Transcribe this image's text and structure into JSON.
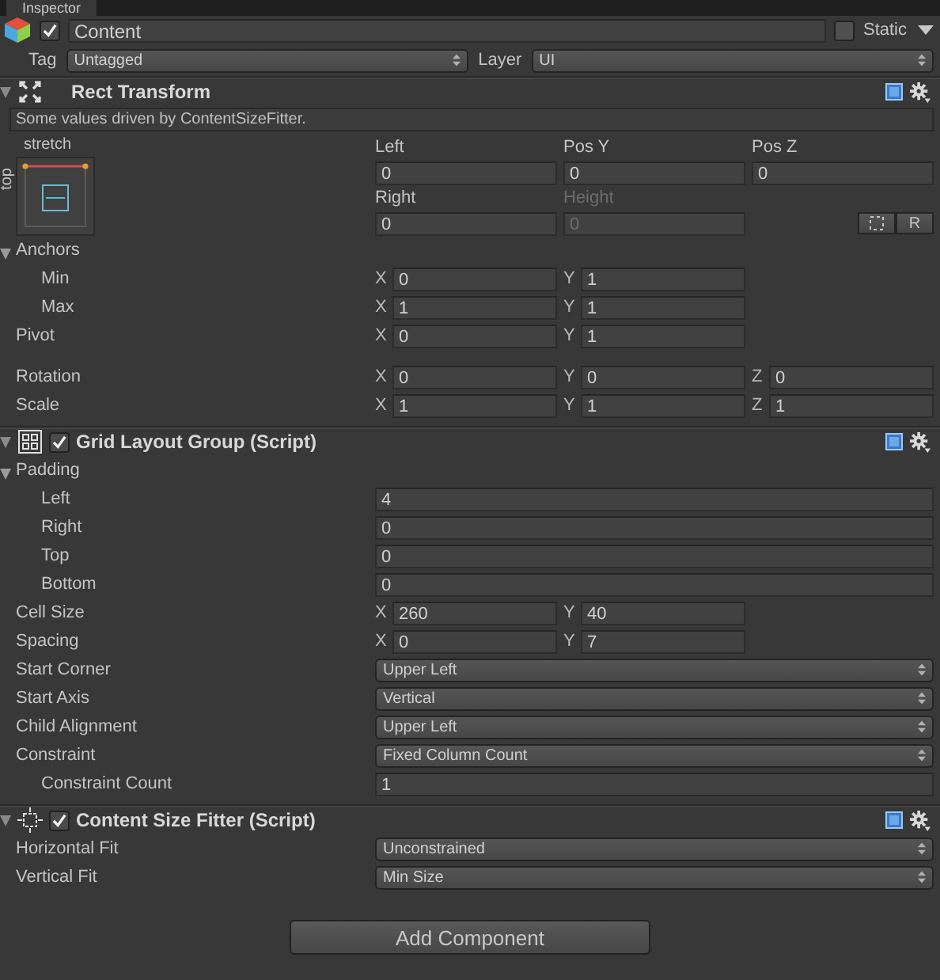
{
  "tab": {
    "title": "Inspector"
  },
  "object": {
    "active": true,
    "name": "Content",
    "static": false,
    "static_label": "Static",
    "tag_label": "Tag",
    "tag": "Untagged",
    "layer_label": "Layer",
    "layer": "UI"
  },
  "components": [
    {
      "kind": "rect_transform",
      "title": "Rect Transform",
      "expanded": true,
      "note": "Some values driven by ContentSizeFitter.",
      "preset_top": "stretch",
      "preset_side": "top",
      "top_fields": [
        {
          "label": "Left",
          "value": "0",
          "disabled": false
        },
        {
          "label": "Pos Y",
          "value": "0",
          "disabled": false
        },
        {
          "label": "Pos Z",
          "value": "0",
          "disabled": false
        },
        {
          "label": "Right",
          "value": "0",
          "disabled": false
        },
        {
          "label": "Height",
          "value": "0",
          "disabled": true
        }
      ],
      "raw_button": "R",
      "rows": [
        {
          "kind": "group",
          "label": "Anchors",
          "expanded": true,
          "children": [
            {
              "kind": "vector",
              "label": "Min",
              "fields": [
                {
                  "axis": "X",
                  "value": "0"
                },
                {
                  "axis": "Y",
                  "value": "1"
                }
              ]
            },
            {
              "kind": "vector",
              "label": "Max",
              "fields": [
                {
                  "axis": "X",
                  "value": "1"
                },
                {
                  "axis": "Y",
                  "value": "1"
                }
              ]
            }
          ]
        },
        {
          "kind": "vector",
          "label": "Pivot",
          "fields": [
            {
              "axis": "X",
              "value": "0"
            },
            {
              "axis": "Y",
              "value": "1"
            }
          ]
        },
        {
          "kind": "vector",
          "label": "Rotation",
          "gap_before": true,
          "fields": [
            {
              "axis": "X",
              "value": "0"
            },
            {
              "axis": "Y",
              "value": "0"
            },
            {
              "axis": "Z",
              "value": "0"
            }
          ]
        },
        {
          "kind": "vector",
          "label": "Scale",
          "fields": [
            {
              "axis": "X",
              "value": "1"
            },
            {
              "axis": "Y",
              "value": "1"
            },
            {
              "axis": "Z",
              "value": "1"
            }
          ]
        }
      ]
    },
    {
      "kind": "grid_layout",
      "title": "Grid Layout Group (Script)",
      "enabled": true,
      "expanded": true,
      "rows": [
        {
          "kind": "group",
          "label": "Padding",
          "expanded": true,
          "children": [
            {
              "kind": "number",
              "label": "Left",
              "value": "4"
            },
            {
              "kind": "number",
              "label": "Right",
              "value": "0"
            },
            {
              "kind": "number",
              "label": "Top",
              "value": "0"
            },
            {
              "kind": "number",
              "label": "Bottom",
              "value": "0"
            }
          ]
        },
        {
          "kind": "vector",
          "label": "Cell Size",
          "fields": [
            {
              "axis": "X",
              "value": "260"
            },
            {
              "axis": "Y",
              "value": "40"
            }
          ]
        },
        {
          "kind": "vector",
          "label": "Spacing",
          "fields": [
            {
              "axis": "X",
              "value": "0"
            },
            {
              "axis": "Y",
              "value": "7"
            }
          ]
        },
        {
          "kind": "dropdown",
          "label": "Start Corner",
          "value": "Upper Left"
        },
        {
          "kind": "dropdown",
          "label": "Start Axis",
          "value": "Vertical"
        },
        {
          "kind": "dropdown",
          "label": "Child Alignment",
          "value": "Upper Left"
        },
        {
          "kind": "dropdown",
          "label": "Constraint",
          "value": "Fixed Column Count"
        },
        {
          "kind": "number",
          "label": "Constraint Count",
          "value": "1",
          "indented": true
        }
      ]
    },
    {
      "kind": "size_fitter",
      "title": "Content Size Fitter (Script)",
      "enabled": true,
      "expanded": true,
      "rows": [
        {
          "kind": "dropdown",
          "label": "Horizontal Fit",
          "value": "Unconstrained"
        },
        {
          "kind": "dropdown",
          "label": "Vertical Fit",
          "value": "Min Size"
        }
      ]
    }
  ],
  "add_button": "Add Component"
}
